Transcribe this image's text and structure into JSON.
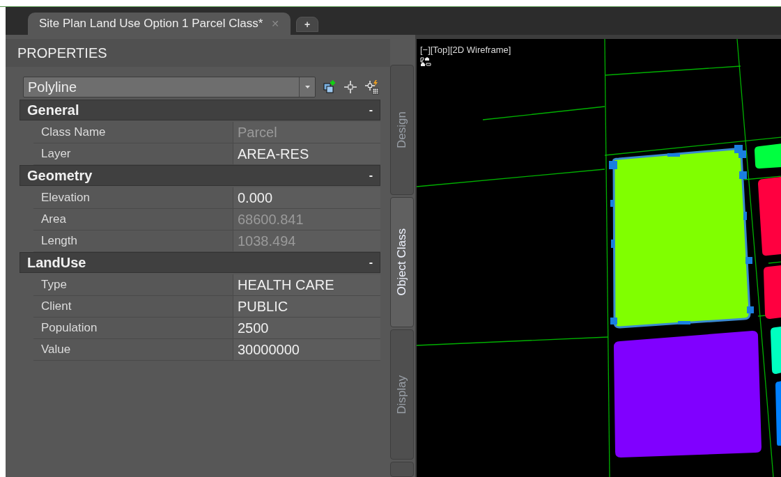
{
  "document_tabs": [
    {
      "label": "Site Plan Land Use Option 1 Parcel Class*",
      "close": "✕",
      "selected": true
    }
  ],
  "new_tab": "+",
  "properties": {
    "title": "PROPERTIES",
    "object_type": "Polyline",
    "sections": [
      {
        "title": "General",
        "toggle": "-",
        "rows": [
          {
            "label": "Class Name",
            "value": "Parcel",
            "disabled": true
          },
          {
            "label": "Layer",
            "value": "AREA-RES",
            "disabled": false
          }
        ]
      },
      {
        "title": "Geometry",
        "toggle": "-",
        "rows": [
          {
            "label": "Elevation",
            "value": "0.000",
            "disabled": false
          },
          {
            "label": "Area",
            "value": "68600.841",
            "disabled": true
          },
          {
            "label": "Length",
            "value": "1038.494",
            "disabled": true
          }
        ]
      },
      {
        "title": "LandUse",
        "toggle": "-",
        "rows": [
          {
            "label": "Type",
            "value": "HEALTH CARE",
            "disabled": false
          },
          {
            "label": "Client",
            "value": "PUBLIC",
            "disabled": false
          },
          {
            "label": "Population",
            "value": "2500",
            "disabled": false
          },
          {
            "label": "Value",
            "value": "30000000",
            "disabled": false
          }
        ]
      }
    ]
  },
  "side_tabs": [
    {
      "label": "Design",
      "selected": false
    },
    {
      "label": "Object Class",
      "selected": true
    },
    {
      "label": "Display",
      "selected": false
    }
  ],
  "viewport": {
    "label": "[−][Top][2D Wireframe]"
  }
}
